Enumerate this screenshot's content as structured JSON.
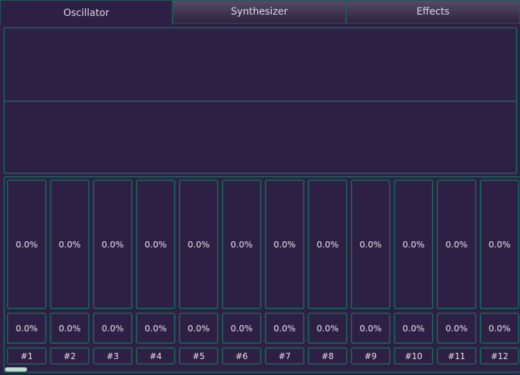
{
  "tabs": [
    {
      "label": "Oscillator",
      "active": true
    },
    {
      "label": "Synthesizer",
      "active": false
    },
    {
      "label": "Effects",
      "active": false
    }
  ],
  "channels": [
    {
      "label": "#1",
      "level": "0.0%",
      "value": "0.0%"
    },
    {
      "label": "#2",
      "level": "0.0%",
      "value": "0.0%"
    },
    {
      "label": "#3",
      "level": "0.0%",
      "value": "0.0%"
    },
    {
      "label": "#4",
      "level": "0.0%",
      "value": "0.0%"
    },
    {
      "label": "#5",
      "level": "0.0%",
      "value": "0.0%"
    },
    {
      "label": "#6",
      "level": "0.0%",
      "value": "0.0%"
    },
    {
      "label": "#7",
      "level": "0.0%",
      "value": "0.0%"
    },
    {
      "label": "#8",
      "level": "0.0%",
      "value": "0.0%"
    },
    {
      "label": "#9",
      "level": "0.0%",
      "value": "0.0%"
    },
    {
      "label": "#10",
      "level": "0.0%",
      "value": "0.0%"
    },
    {
      "label": "#11",
      "level": "0.0%",
      "value": "0.0%"
    },
    {
      "label": "#12",
      "level": "0.0%",
      "value": "0.0%"
    }
  ]
}
